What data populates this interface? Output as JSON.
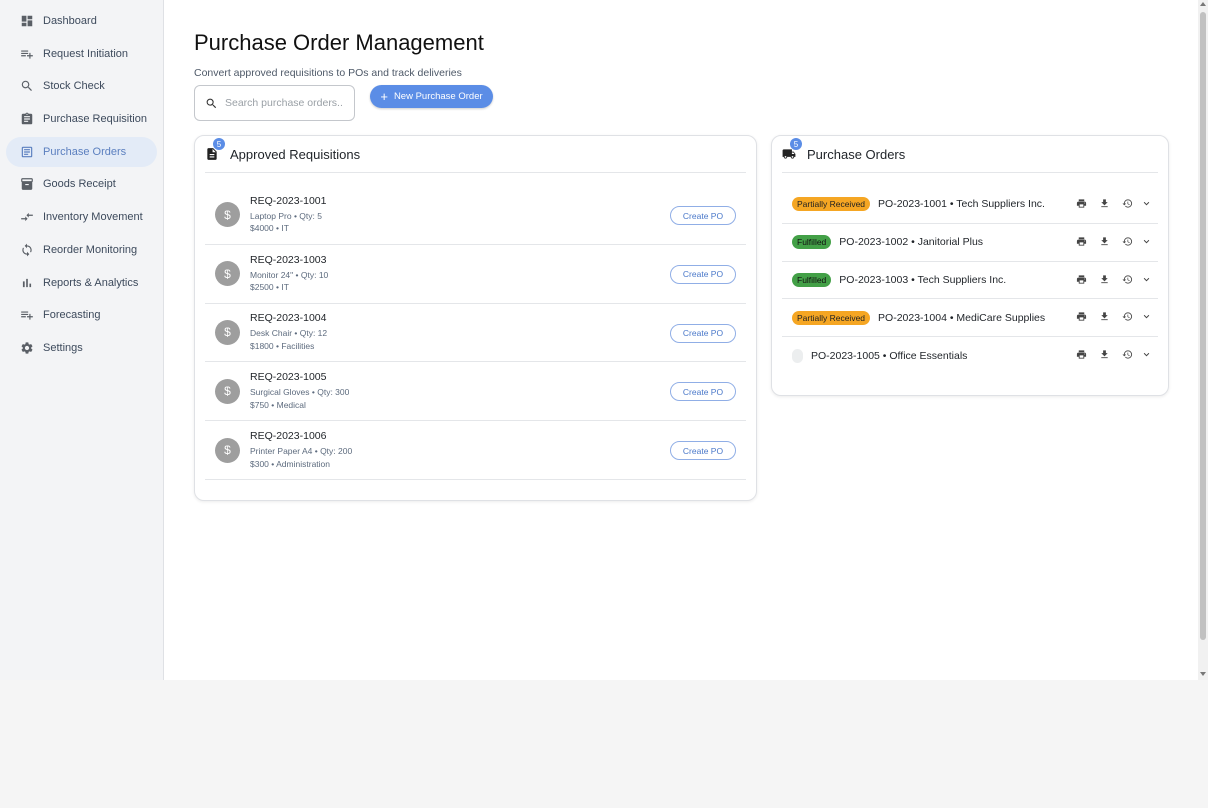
{
  "sidebar": {
    "items": [
      {
        "label": "Dashboard",
        "icon": "dashboard-icon"
      },
      {
        "label": "Request Initiation",
        "icon": "playlist-add-icon"
      },
      {
        "label": "Stock Check",
        "icon": "search-icon"
      },
      {
        "label": "Purchase Requisition",
        "icon": "clipboard-icon"
      },
      {
        "label": "Purchase Orders",
        "icon": "receipt-icon",
        "active": true
      },
      {
        "label": "Goods Receipt",
        "icon": "archive-icon"
      },
      {
        "label": "Inventory Movement",
        "icon": "compare-arrows-icon"
      },
      {
        "label": "Reorder Monitoring",
        "icon": "sync-icon"
      },
      {
        "label": "Reports & Analytics",
        "icon": "bar-chart-icon"
      },
      {
        "label": "Forecasting",
        "icon": "playlist-add-icon"
      },
      {
        "label": "Settings",
        "icon": "gear-icon"
      }
    ]
  },
  "header": {
    "title": "Purchase Order Management",
    "subtitle": "Convert approved requisitions to POs and track deliveries"
  },
  "search": {
    "placeholder": "Search purchase orders..."
  },
  "toolbar": {
    "new_po_label": "New Purchase Order",
    "new_po_glyph": "+"
  },
  "approved": {
    "title": "Approved Requisitions",
    "count": "5",
    "create_label": "Create PO",
    "avatar_glyph": "$",
    "items": [
      {
        "id": "REQ-2023-1001",
        "line1": "Laptop Pro • Qty: 5",
        "line2": "$4000 • IT"
      },
      {
        "id": "REQ-2023-1003",
        "line1": "Monitor 24\" • Qty: 10",
        "line2": "$2500 • IT"
      },
      {
        "id": "REQ-2023-1004",
        "line1": "Desk Chair • Qty: 12",
        "line2": "$1800 • Facilities"
      },
      {
        "id": "REQ-2023-1005",
        "line1": "Surgical Gloves • Qty: 300",
        "line2": "$750 • Medical"
      },
      {
        "id": "REQ-2023-1006",
        "line1": "Printer Paper A4 • Qty: 200",
        "line2": "$300 • Administration"
      }
    ]
  },
  "orders": {
    "title": "Purchase Orders",
    "count": "5",
    "items": [
      {
        "status": "Partially Received",
        "kind": "partial",
        "text": "PO-2023-1001 • Tech Suppliers Inc."
      },
      {
        "status": "Fulfilled",
        "kind": "fulfilled",
        "text": "PO-2023-1002 • Janitorial Plus"
      },
      {
        "status": "Fulfilled",
        "kind": "fulfilled",
        "text": "PO-2023-1003 • Tech Suppliers Inc."
      },
      {
        "status": "Partially Received",
        "kind": "partial",
        "text": "PO-2023-1004 • MediCare Supplies"
      },
      {
        "status": "",
        "kind": "empty",
        "text": "PO-2023-1005 • Office Essentials"
      }
    ]
  },
  "colors": {
    "accent": "#5b8de6",
    "partial": "#f5a623",
    "fulfilled": "#43a047"
  }
}
